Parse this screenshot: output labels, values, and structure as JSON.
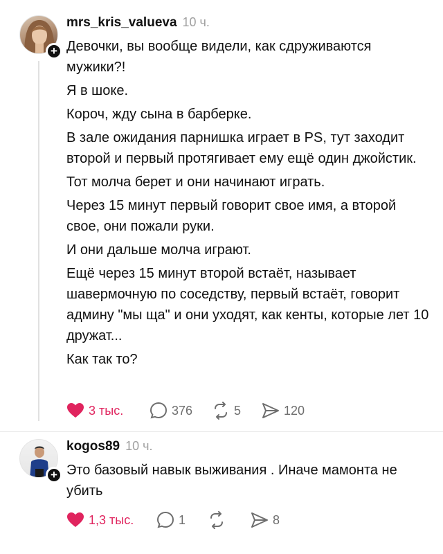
{
  "comments": [
    {
      "username": "mrs_kris_valueva",
      "time": "10 ч.",
      "paragraphs": [
        "Девочки, вы вообще видели, как сдруживаются мужики?!",
        "Я в шоке.",
        "Короч, жду сына в барберке.",
        "В зале ожидания парнишка играет в PS, тут заходит второй и первый протягивает ему ещё один джойстик.",
        "Тот молча берет и они начинают играть.",
        "Через 15 минут первый говорит свое имя, а второй свое, они пожали руки.",
        "И они дальше молча играют.",
        "Ещё через 15 минут второй встаёт, называет шавермочную по соседству, первый встаёт, говорит админу \"мы ща\" и они уходят, как кенты, которые лет 10 дружат...",
        "Как так то?"
      ],
      "likes": "3 тыс.",
      "replies": "376",
      "reposts": "5",
      "shares": "120"
    },
    {
      "username": "kogos89",
      "time": "10 ч.",
      "paragraphs": [
        "Это базовый навык выживания . Иначе мамонта не убить"
      ],
      "likes": "1,3 тыс.",
      "replies": "1",
      "reposts": "",
      "shares": "8"
    }
  ],
  "colors": {
    "like": "#e0245e",
    "muted": "#6e6e6e",
    "time": "#a0a0a0"
  },
  "icons": [
    "heart-icon",
    "comment-icon",
    "repost-icon",
    "share-icon",
    "plus-icon"
  ]
}
